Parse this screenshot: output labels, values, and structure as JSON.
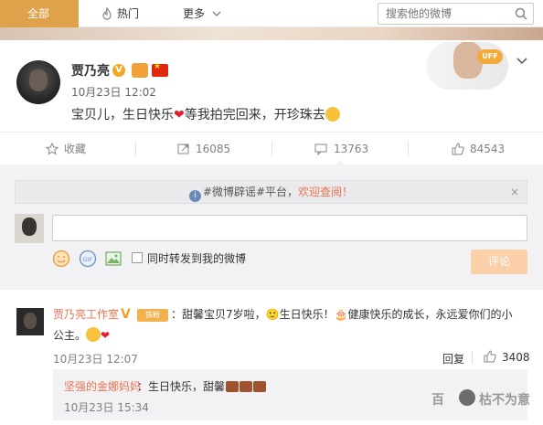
{
  "topbar": {
    "tab_all": "全部",
    "tab_hot": "热门",
    "tab_more": "更多",
    "search_placeholder": "搜索他的微博"
  },
  "post": {
    "author": "贾乃亮",
    "verified_badge": "V",
    "time": "10月23日 12:02",
    "text_before_heart": "宝贝儿，生日快乐",
    "heart": "❤",
    "text_after_heart": "等我拍完回来，开珍珠去",
    "sticker_tag": "UFF"
  },
  "actions": {
    "favorite": "收藏",
    "repost_count": "16085",
    "comment_count": "13763",
    "like_count": "84543"
  },
  "comment_box": {
    "notice_hash": "#微博辟谣#平台，",
    "notice_link": "欢迎查阅！",
    "notice_close": "×",
    "also_repost_label": "同时转发到我的微博",
    "submit_label": "评论"
  },
  "comment": {
    "author": "贾乃亮工作室",
    "verified": "V",
    "fan_badge": "铁粉",
    "text_line1": "：甜馨宝贝7岁啦，🙂生日快乐！🎂健康快乐的成长，永远爱你们的小",
    "text_line2": "公主。",
    "heart": "❤",
    "time": "10月23日 12:07",
    "reply_label": "回复",
    "like_count": "3408"
  },
  "reply": {
    "author": "坚强的金娜妈妈",
    "text": "：生日快乐，甜馨",
    "time": "10月23日 15:34"
  },
  "watermark": {
    "text": "百",
    "brand": "枯不为意"
  }
}
